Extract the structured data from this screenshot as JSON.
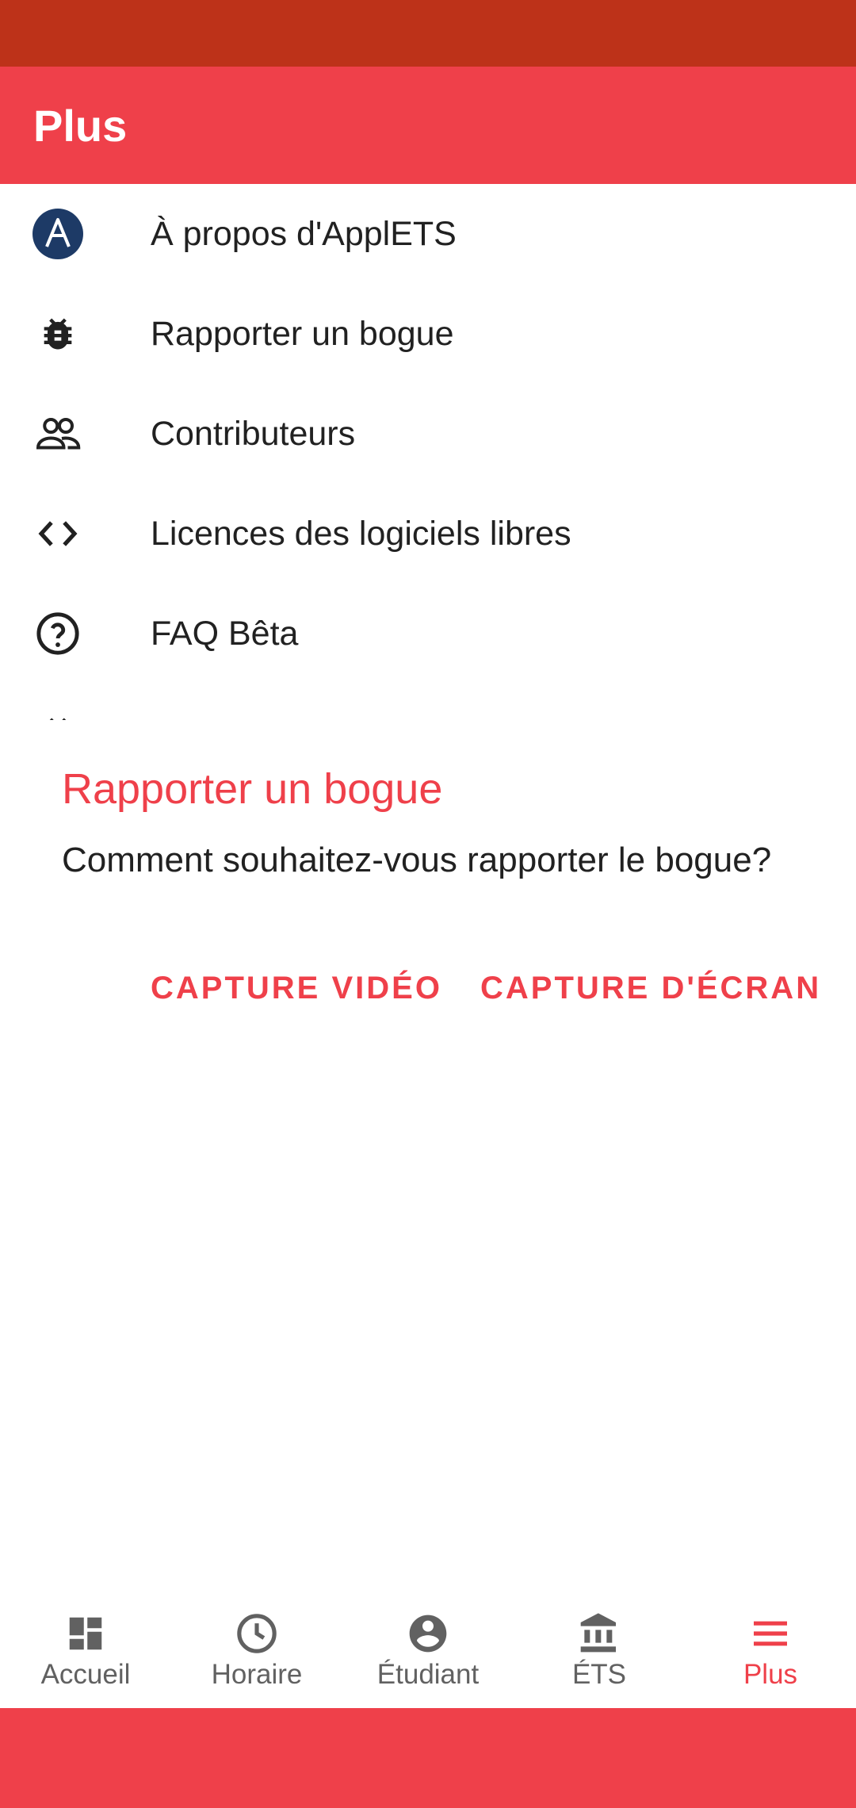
{
  "app_bar": {
    "title": "Plus"
  },
  "menu": {
    "items": [
      {
        "label": "À propos d'ApplETS",
        "icon": "applets-logo-icon"
      },
      {
        "label": "Rapporter un bogue",
        "icon": "bug-icon"
      },
      {
        "label": "Contributeurs",
        "icon": "people-icon"
      },
      {
        "label": "Licences des logiciels libres",
        "icon": "code-icon"
      },
      {
        "label": "FAQ Bêta",
        "icon": "help-circle-icon"
      }
    ]
  },
  "dialog": {
    "title": "Rapporter un bogue",
    "message": "Comment souhaitez-vous rapporter le bogue?",
    "video_button": "CAPTURE VIDÉO",
    "screenshot_button": "CAPTURE D'ÉCRAN"
  },
  "bottom_nav": {
    "items": [
      {
        "label": "Accueil",
        "icon": "dashboard-icon",
        "active": false
      },
      {
        "label": "Horaire",
        "icon": "clock-icon",
        "active": false
      },
      {
        "label": "Étudiant",
        "icon": "account-circle-icon",
        "active": false
      },
      {
        "label": "ÉTS",
        "icon": "institution-icon",
        "active": false
      },
      {
        "label": "Plus",
        "icon": "menu-icon",
        "active": true
      }
    ]
  },
  "colors": {
    "status_bar": "#bd3219",
    "accent": "#ef404a",
    "inactive": "#616161",
    "logo_bg": "#1d3a66"
  }
}
